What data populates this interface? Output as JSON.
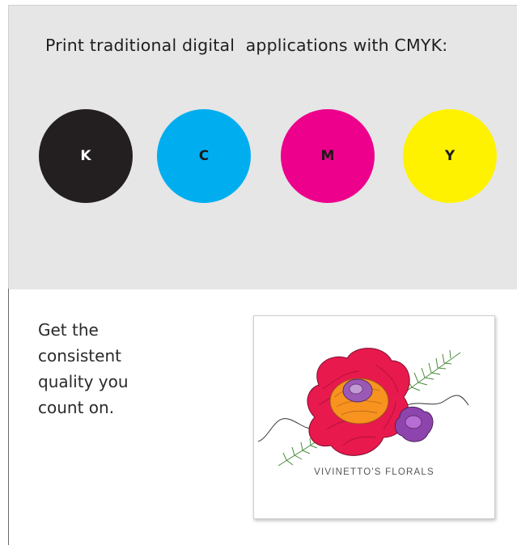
{
  "headline": "Print traditional digital  applications with CMYK:",
  "swatches": [
    {
      "label": "K",
      "color": "#231f20",
      "text_color": "#ffffff"
    },
    {
      "label": "C",
      "color": "#00aeef",
      "text_color": "#1a1a1a"
    },
    {
      "label": "M",
      "color": "#ec008c",
      "text_color": "#1a1a1a"
    },
    {
      "label": "Y",
      "color": "#fff200",
      "text_color": "#1a1a1a"
    }
  ],
  "tagline": [
    "Get the",
    "consistent",
    "quality you",
    "count on."
  ],
  "logo": {
    "name": "VIVINETTO'S FLORALS"
  }
}
